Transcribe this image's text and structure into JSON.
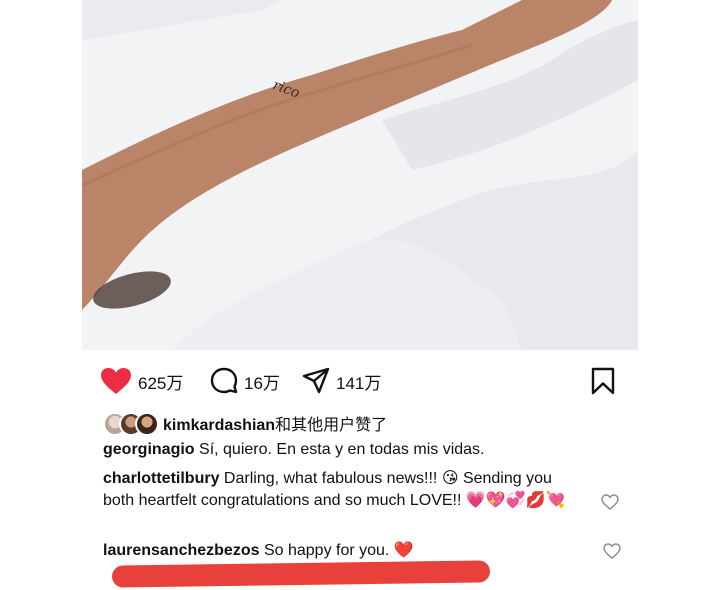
{
  "post": {
    "actions": {
      "likes_count": "625万",
      "comments_count": "16万",
      "shares_count": "141万"
    },
    "liked_by": {
      "username": "kimkardashian",
      "suffix": "和其他用户赞了"
    },
    "caption": {
      "username": "georginagio",
      "text": "Sí, quiero. En esta y en todas mis vidas."
    },
    "comments": [
      {
        "username": "charlottetilbury",
        "text": "Darling, what fabulous news!!! 😘 Sending you both heartfelt congratulations and so much LOVE!! 💗💖💞💋💘"
      },
      {
        "username": "laurensanchezbezos",
        "text": "So happy for you. ❤️"
      }
    ]
  },
  "colors": {
    "like_red": "#ed2d45",
    "strike_red": "#e8403a"
  },
  "icons": [
    "heart-filled-icon",
    "comment-icon",
    "share-icon",
    "bookmark-icon",
    "heart-outline-icon"
  ]
}
